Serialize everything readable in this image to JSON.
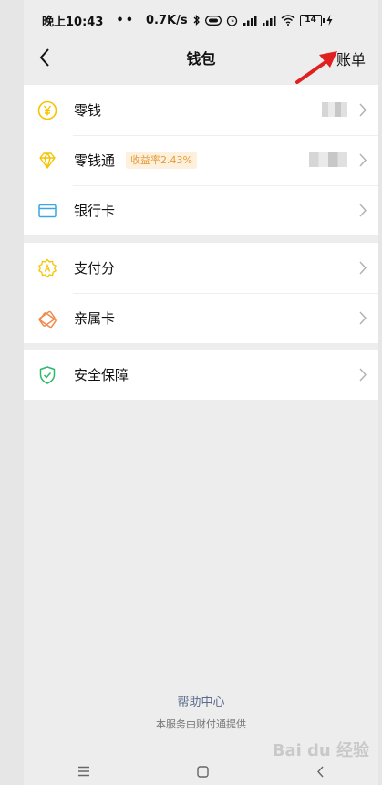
{
  "status_bar": {
    "time": "晚上10:43",
    "dots": "••",
    "speed": "0.7K/s",
    "battery": "14"
  },
  "nav": {
    "title": "钱包",
    "bill": "账单"
  },
  "sections": [
    {
      "items": [
        {
          "label": "零钱",
          "icon": "yuan-icon",
          "color": "#f5c400"
        },
        {
          "label": "零钱通",
          "icon": "diamond-icon",
          "color": "#f5c400",
          "badge": "收益率2.43%"
        },
        {
          "label": "银行卡",
          "icon": "bank-card-icon",
          "color": "#3aa7e0"
        }
      ]
    },
    {
      "items": [
        {
          "label": "支付分",
          "icon": "pay-score-icon",
          "color": "#f5c400"
        },
        {
          "label": "亲属卡",
          "icon": "family-card-icon",
          "color": "#f08a4b"
        }
      ]
    },
    {
      "items": [
        {
          "label": "安全保障",
          "icon": "shield-icon",
          "color": "#2db96d"
        }
      ]
    }
  ],
  "footer": {
    "help": "帮助中心",
    "service": "本服务由财付通提供"
  },
  "watermark": "Bai du 经验"
}
